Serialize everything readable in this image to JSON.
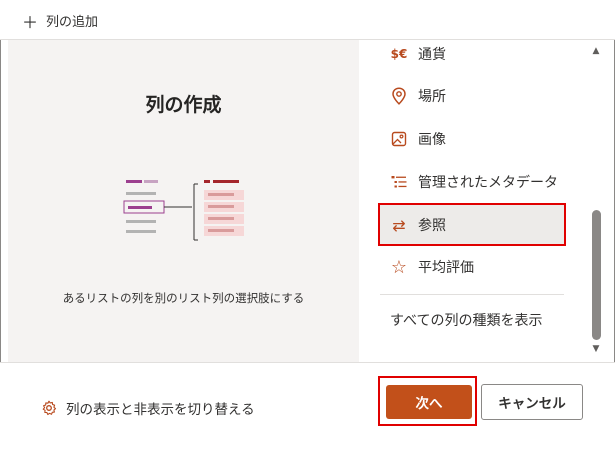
{
  "header": {
    "add_icon": "plus-icon",
    "title": "列の追加"
  },
  "create": {
    "heading": "列の作成",
    "description": "あるリストの列を別のリスト列の選択肢にする"
  },
  "column_types": [
    {
      "icon": "currency-icon",
      "icon_glyph": "$€",
      "label": "通貨"
    },
    {
      "icon": "location-icon",
      "icon_glyph": "",
      "label": "場所"
    },
    {
      "icon": "image-icon",
      "icon_glyph": "",
      "label": "画像"
    },
    {
      "icon": "managed-metadata-icon",
      "icon_glyph": "",
      "label": "管理されたメタデータ"
    },
    {
      "icon": "lookup-icon",
      "icon_glyph": "⇄",
      "label": "参照",
      "selected": true
    },
    {
      "icon": "star-icon",
      "icon_glyph": "☆",
      "label": "平均評価"
    }
  ],
  "show_all_label": "すべての列の種類を表示",
  "footer": {
    "toggle_label": "列の表示と非表示を切り替える",
    "next_label": "次へ",
    "cancel_label": "キャンセル"
  },
  "colors": {
    "accent": "#c2501a",
    "highlight": "#e00000",
    "panel_bg": "#f5f3f2",
    "selected_bg": "#edebe9"
  }
}
